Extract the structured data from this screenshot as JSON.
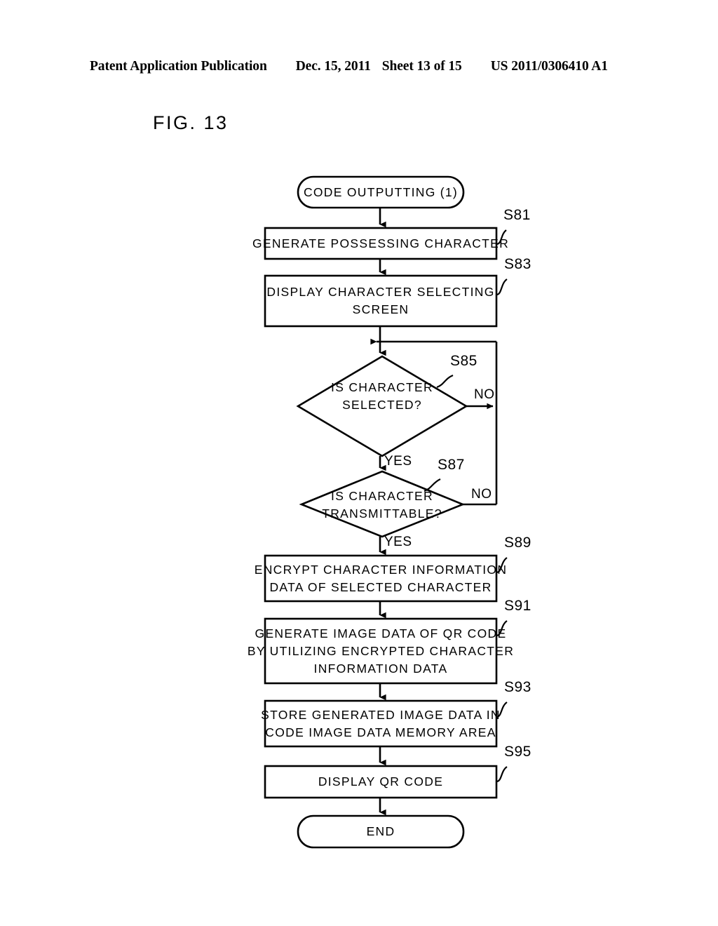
{
  "header": {
    "publication": "Patent Application Publication",
    "date": "Dec. 15, 2011",
    "sheet": "Sheet 13 of 15",
    "number": "US 2011/0306410 A1"
  },
  "figure": {
    "label": "FIG. 13"
  },
  "flowchart": {
    "start": {
      "text": "CODE OUTPUTTING (1)"
    },
    "end": {
      "text": "END"
    },
    "steps": [
      {
        "id": "S81",
        "lines": [
          "GENERATE POSSESSING CHARACTER"
        ]
      },
      {
        "id": "S83",
        "lines": [
          "DISPLAY CHARACTER SELECTING",
          "SCREEN"
        ]
      },
      {
        "id": "S85",
        "lines": [
          "IS CHARACTER",
          "SELECTED?"
        ],
        "shape": "decision",
        "yes": "YES",
        "no": "NO"
      },
      {
        "id": "S87",
        "lines": [
          "IS CHARACTER",
          "TRANSMITTABLE?"
        ],
        "shape": "decision",
        "yes": "YES",
        "no": "NO"
      },
      {
        "id": "S89",
        "lines": [
          "ENCRYPT CHARACTER INFORMATION",
          "DATA OF SELECTED CHARACTER"
        ]
      },
      {
        "id": "S91",
        "lines": [
          "GENERATE IMAGE DATA OF QR CODE",
          "BY UTILIZING ENCRYPTED CHARACTER",
          "INFORMATION DATA"
        ]
      },
      {
        "id": "S93",
        "lines": [
          "STORE GENERATED IMAGE DATA IN",
          "CODE IMAGE DATA MEMORY AREA"
        ]
      },
      {
        "id": "S95",
        "lines": [
          "DISPLAY QR CODE"
        ]
      }
    ]
  },
  "colors": {
    "ink": "#000000",
    "paper": "#ffffff"
  }
}
